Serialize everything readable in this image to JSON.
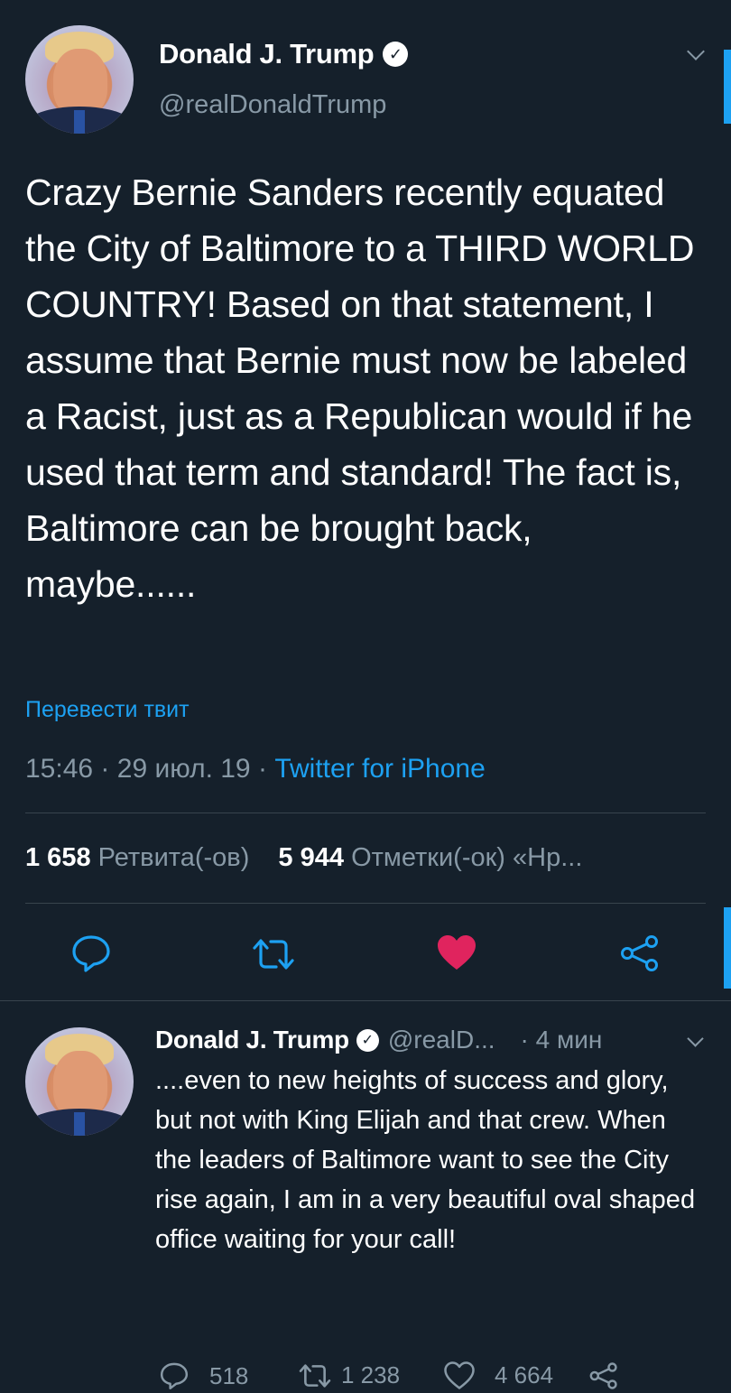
{
  "main_tweet": {
    "author_name": "Donald J. Trump",
    "author_handle": "@realDonaldTrump",
    "text": "Crazy Bernie Sanders recently equated the City of Baltimore to a THIRD WORLD COUNTRY! Based on that statement, I assume that Bernie must now be labeled a Racist, just as a Republican would if he used that term and standard! The fact is, Baltimore can be brought back, maybe......",
    "translate_label": "Перевести твит",
    "time": "15:46",
    "date": "29 июл. 19",
    "separator": "·",
    "source": "Twitter for iPhone",
    "retweets_count": "1 658",
    "retweets_label": "Ретвита(-ов)",
    "likes_count": "5 944",
    "likes_label": "Отметки(-ок) «Нр..."
  },
  "reply_tweet": {
    "author_name": "Donald J. Trump",
    "author_handle": "@realD...",
    "age": "· 4 мин",
    "text": "....even to new heights of success and glory, but not with King Elijah and that crew. When the leaders of Baltimore want to see the City rise again, I am in a very beautiful oval shaped office waiting for your call!",
    "replies": "518",
    "retweets": "1 238",
    "likes": "4 664"
  },
  "colors": {
    "background": "#15202b",
    "accent": "#1da1f2",
    "like_red": "#e0245e",
    "muted": "#8899a6"
  }
}
